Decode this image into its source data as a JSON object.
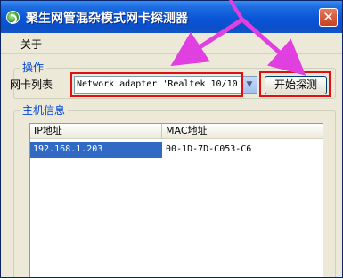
{
  "window": {
    "title": "聚生网管混杂模式网卡探测器",
    "icon": "app-icon"
  },
  "menu": {
    "items": [
      {
        "label": "关于"
      }
    ]
  },
  "operation": {
    "legend": "操作",
    "nic_label": "网卡列表",
    "nic_value": "Network adapter 'Realtek 10/100",
    "start_label": "开始探测"
  },
  "host": {
    "legend": "主机信息",
    "columns": [
      "IP地址",
      "MAC地址"
    ],
    "rows": [
      {
        "ip": "192.168.1.203",
        "mac": "00-1D-7D-C053-C6"
      }
    ]
  },
  "annotation_colors": {
    "highlight": "#e01010",
    "arrow": "#e040e0"
  }
}
